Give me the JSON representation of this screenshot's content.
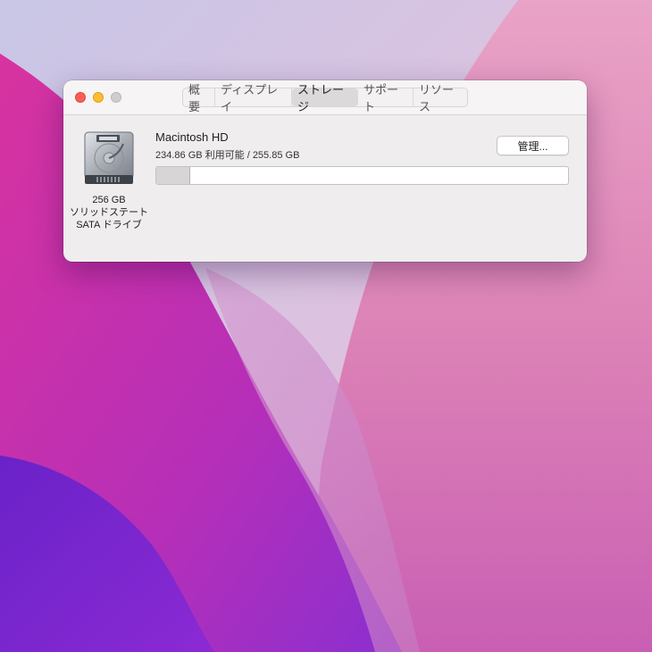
{
  "window": {
    "traffic_lights": [
      "close",
      "minimize",
      "zoom"
    ]
  },
  "tabs": [
    {
      "label": "概要",
      "active": false
    },
    {
      "label": "ディスプレイ",
      "active": false
    },
    {
      "label": "ストレージ",
      "active": true
    },
    {
      "label": "サポート",
      "active": false
    },
    {
      "label": "リソース",
      "active": false
    }
  ],
  "disk": {
    "icon": "hard-drive-icon",
    "capacity": "256 GB",
    "type": "ソリッドステート",
    "interface": "SATA ドライブ"
  },
  "volume": {
    "name": "Macintosh HD",
    "usage_text": "234.86 GB 利用可能 / 255.85 GB",
    "used_fraction": 0.082
  },
  "manage_button": {
    "label": "管理..."
  },
  "colors": {
    "close": "#fe5f57",
    "minimize": "#febc2e",
    "zoom_inactive": "#cfcdcf"
  }
}
